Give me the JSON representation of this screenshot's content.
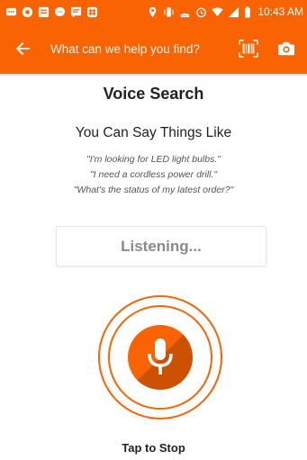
{
  "status_bar": {
    "time": "10:43 AM",
    "left_icons": [
      "chat-icon",
      "app-icon",
      "stack-icon",
      "messenger-icon",
      "message-icon",
      "slack-icon"
    ],
    "right_icons": [
      "location-icon",
      "vibrate-icon",
      "cast-icon",
      "alarm-icon",
      "wifi-icon",
      "signal-icon",
      "battery-icon"
    ]
  },
  "app_bar": {
    "search_placeholder": "What can we help you find?",
    "background": "#f96302"
  },
  "main": {
    "title": "Voice Search",
    "subtitle": "You Can Say Things Like",
    "examples": [
      "\"I'm looking for LED light bulbs.\"",
      "\"I need a cordless power drill.\"",
      "\"What's the status of my latest order?\""
    ],
    "listening_label": "Listening...",
    "tap_to_stop": "Tap to Stop"
  },
  "colors": {
    "accent": "#f96302",
    "text": "#222222",
    "muted": "#8a8a8a"
  }
}
